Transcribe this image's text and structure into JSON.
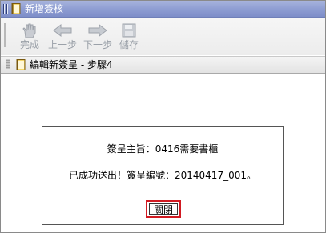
{
  "window": {
    "title": "新增簽核",
    "titlebar_color": "#8f9ed3"
  },
  "toolbar": {
    "items": [
      {
        "label": "完成",
        "icon": "hand-icon"
      },
      {
        "label": "上一步",
        "icon": "back-arrow-icon"
      },
      {
        "label": "下一步",
        "icon": "forward-arrow-icon"
      },
      {
        "label": "儲存",
        "icon": "save-icon"
      }
    ]
  },
  "subheader": {
    "title": "編輯新簽呈 - 步驟4"
  },
  "dialog": {
    "line1": "簽呈主旨：0416需要書櫃",
    "line2": "已成功送出！簽呈編號：20140417_001。",
    "close_label": "關閉",
    "highlight_color": "#d11a22"
  }
}
